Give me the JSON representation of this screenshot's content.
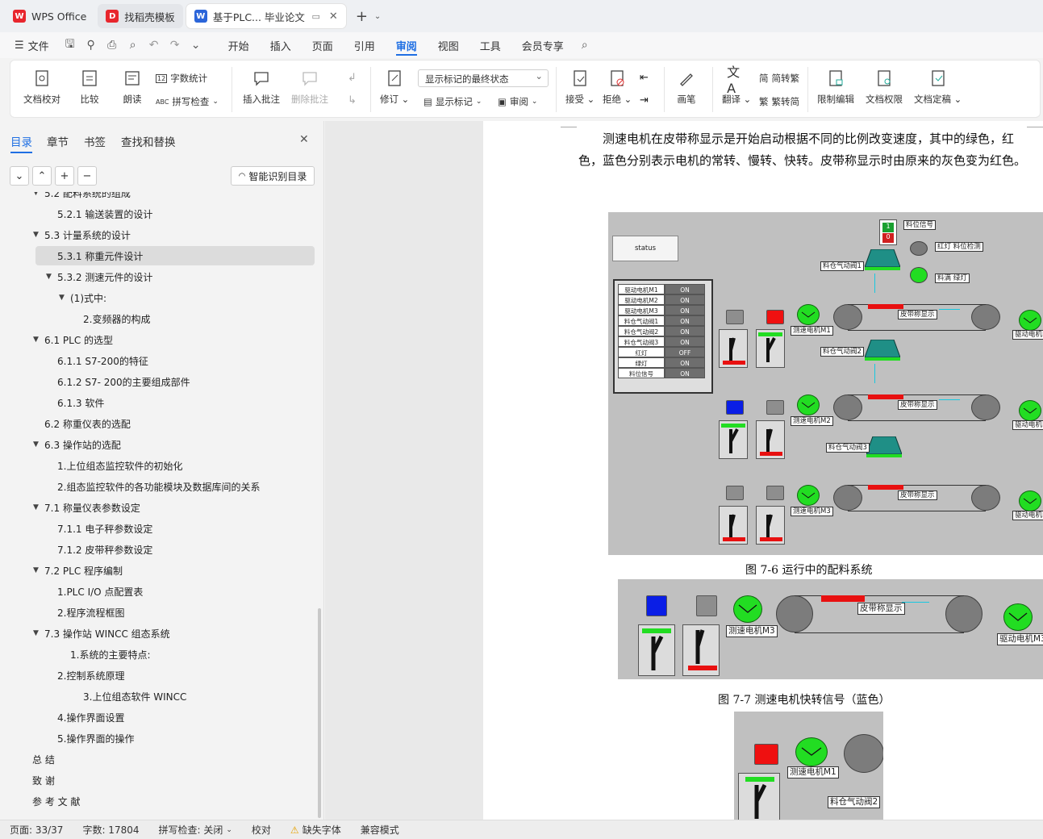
{
  "tabs": [
    {
      "label": "WPS Office",
      "logo": "W",
      "color": "#e8262d"
    },
    {
      "label": "找稻壳模板",
      "logo": "D",
      "color": "#e8262d"
    },
    {
      "label": "基于PLC... 毕业论文",
      "logo": "W",
      "color": "#2b65d9"
    }
  ],
  "menu": {
    "file": "文件",
    "items": [
      "开始",
      "插入",
      "页面",
      "引用",
      "审阅",
      "视图",
      "工具",
      "会员专享"
    ],
    "active": "审阅"
  },
  "ribbon": {
    "doc_check": "文档校对",
    "compare": "比较",
    "read": "朗读",
    "word_count": "字数统计",
    "spell_check": "拼写检查",
    "insert_comment": "插入批注",
    "delete_comment": "删除批注",
    "track": "修订",
    "show_markup": "显示标记",
    "review": "审阅",
    "markup_state": "显示标记的最终状态",
    "accept": "接受",
    "reject": "拒绝",
    "pen": "画笔",
    "translate": "翻译",
    "to_trad": "简转繁",
    "to_simp": "繁转简",
    "restrict": "限制编辑",
    "permission": "文档权限",
    "finalize": "文档定稿"
  },
  "nav": {
    "tabs": [
      "目录",
      "章节",
      "书签",
      "查找和替换"
    ],
    "smart_btn": "智能识别目录",
    "toc": [
      {
        "text": "5.2  配料系统的组成",
        "level": 1,
        "arrow": true
      },
      {
        "text": "5.2.1  输送装置的设计",
        "level": 2
      },
      {
        "text": "5.3  计量系统的设计",
        "level": 1,
        "arrow": true
      },
      {
        "text": "5.3.1  称重元件设计",
        "level": 2,
        "selected": true
      },
      {
        "text": "5.3.2  测速元件的设计",
        "level": 2,
        "arrow": true
      },
      {
        "text": "(1)式中:",
        "level": 3,
        "arrow": true
      },
      {
        "text": "2.变频器的构成",
        "level": 4
      },
      {
        "text": "6.1 PLC 的选型",
        "level": 1,
        "arrow": true
      },
      {
        "text": "6.1.1 S7-200的特征",
        "level": 2
      },
      {
        "text": "6.1.2 S7- 200的主要组成部件",
        "level": 2
      },
      {
        "text": "6.1.3  软件",
        "level": 2
      },
      {
        "text": "6.2  称重仪表的选配",
        "level": 1
      },
      {
        "text": "6.3  操作站的选配",
        "level": 1,
        "arrow": true
      },
      {
        "text": "1.上位组态监控软件的初始化",
        "level": 2
      },
      {
        "text": "2.组态监控软件的各功能模块及数据库间的关系",
        "level": 2
      },
      {
        "text": "7.1  称量仪表参数设定",
        "level": 1,
        "arrow": true
      },
      {
        "text": "7.1.1  电子秤参数设定",
        "level": 2
      },
      {
        "text": "7.1.2  皮带秤参数设定",
        "level": 2
      },
      {
        "text": "7.2 PLC 程序编制",
        "level": 1,
        "arrow": true
      },
      {
        "text": "1.PLC I/O 点配置表",
        "level": 2
      },
      {
        "text": "2.程序流程框图",
        "level": 2
      },
      {
        "text": "7.3 操作站 WINCC 组态系统",
        "level": 1,
        "arrow": true
      },
      {
        "text": "1.系统的主要特点:",
        "level": 3
      },
      {
        "text": "2.控制系统原理",
        "level": 2
      },
      {
        "text": "3.上位组态软件 WINCC",
        "level": 4
      },
      {
        "text": "4.操作界面设置",
        "level": 2
      },
      {
        "text": "5.操作界面的操作",
        "level": 2
      },
      {
        "text": "总   结",
        "level": 0
      },
      {
        "text": "致   谢",
        "level": 0
      },
      {
        "text": "参 考 文 献",
        "level": 0
      }
    ]
  },
  "doc": {
    "paragraph": "测速电机在皮带称显示是开始启动根据不同的比例改变速度，其中的绿色，红色，蓝色分别表示电机的常转、慢转、快转。皮带称显示时由原来的灰色变为红色。",
    "caption1": "图 7-6 运行中的配料系统",
    "caption2": "图 7-7  测速电机快转信号（蓝色）",
    "fig1": {
      "status": "status",
      "status_rows": [
        {
          "name": "驱动电机M1",
          "state": "ON"
        },
        {
          "name": "驱动电机M2",
          "state": "ON"
        },
        {
          "name": "驱动电机M3",
          "state": "ON"
        },
        {
          "name": "料仓气动阀1",
          "state": "ON"
        },
        {
          "name": "料仓气动阀2",
          "state": "ON"
        },
        {
          "name": "料仓气动阀3",
          "state": "ON"
        },
        {
          "name": "红灯",
          "state": "OFF"
        },
        {
          "name": "绿灯",
          "state": "ON"
        },
        {
          "name": "料位信号",
          "state": "ON"
        }
      ],
      "level_signal": "料位信号",
      "level_digits": [
        "1",
        "0"
      ],
      "red_lamp": "红灯 料位检测",
      "green_lamp": "料满 绿灯",
      "valve1": "料仓气动阀1",
      "valve2": "料仓气动阀2",
      "valve3": "料仓气动阀3",
      "speed1": "测速电机M1",
      "speed2": "测速电机M2",
      "speed3": "测速电机M3",
      "belt_label": "皮带称显示",
      "drive1": "驱动电机M",
      "drive2": "驱动电机M",
      "drive3": "驱动电机M"
    },
    "fig2": {
      "speed": "测速电机M3",
      "belt_label": "皮带称显示",
      "drive": "驱动电机M3"
    },
    "fig3": {
      "speed": "测速电机M1",
      "valve": "料仓气动阀2"
    }
  },
  "status": {
    "page": "页面: 33/37",
    "words": "字数: 17804",
    "spell": "拼写检查: 关闭",
    "proof": "校对",
    "missing_font": "缺失字体",
    "compat": "兼容模式"
  },
  "colors": {
    "accent": "#1f6fe3",
    "motor": "#22dd22",
    "red": "#e81010",
    "blue": "#0a1ee6",
    "valve": "#1f8f86"
  }
}
